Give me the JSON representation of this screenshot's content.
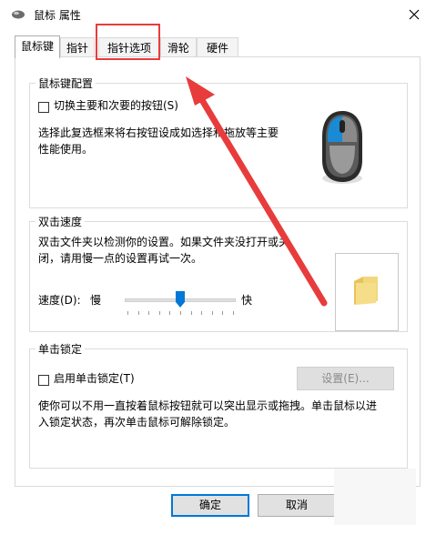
{
  "window": {
    "title": "鼠标 属性"
  },
  "tabs": [
    {
      "label": "鼠标键"
    },
    {
      "label": "指针"
    },
    {
      "label": "指针选项"
    },
    {
      "label": "滑轮"
    },
    {
      "label": "硬件"
    }
  ],
  "active_tab": "鼠标键",
  "button_config": {
    "title": "鼠标键配置",
    "swap_label": "切换主要和次要的按钮(S)",
    "swap_checked": false,
    "description": [
      "选择此复选框来将右按钮设成如选择和拖放等主要",
      "性能使用。"
    ]
  },
  "double_click": {
    "title": "双击速度",
    "description": [
      "双击文件夹以检测你的设置。如果文件夹没打开或关",
      "闭，请用慢一点的设置再试一次。"
    ],
    "speed_label": "速度(D):",
    "slow_label": "慢",
    "fast_label": "快",
    "speed_value": 0.5
  },
  "click_lock": {
    "title": "单击锁定",
    "enable_label": "启用单击锁定(T)",
    "enable_checked": false,
    "settings_button": "设置(E)...",
    "description": [
      "使你可以不用一直按着鼠标按钮就可以突出显示或拖拽。单击鼠标以进",
      "入锁定状态，再次单击鼠标可解除锁定。"
    ]
  },
  "footer": {
    "ok": "确定",
    "cancel": "取消"
  },
  "colors": {
    "accent": "#0078d7",
    "annotation": "#e83c3c"
  },
  "icons": [
    "mouse-settings-icon",
    "close-icon",
    "mouse-icon",
    "folder-icon"
  ]
}
